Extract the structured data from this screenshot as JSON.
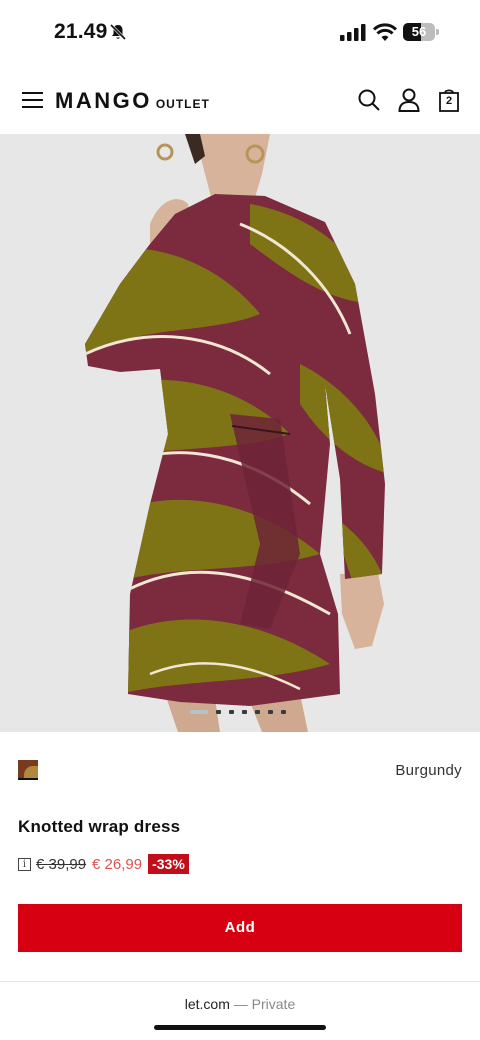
{
  "status_bar": {
    "time": "21.49",
    "battery_percent": "56",
    "battery_level": 0.56
  },
  "header": {
    "logo_main": "MANGO",
    "logo_sub": "OUTLET",
    "bag_count": "2",
    "icons": [
      "menu-icon",
      "search-icon",
      "account-icon",
      "bag-icon"
    ]
  },
  "gallery": {
    "image_count": 7,
    "active_index": 0,
    "colors": {
      "burgundy": "#7c2a3e",
      "olive": "#7e7416",
      "background": "#e6e7e6"
    }
  },
  "product": {
    "color_name": "Burgundy",
    "title": "Knotted wrap dress",
    "info_icon": "i",
    "old_price": "€ 39,99",
    "new_price": "€ 26,99",
    "discount": "-33%",
    "add_label": "Add"
  },
  "browser": {
    "url": "let.com",
    "separator": " — ",
    "mode": "Private"
  }
}
